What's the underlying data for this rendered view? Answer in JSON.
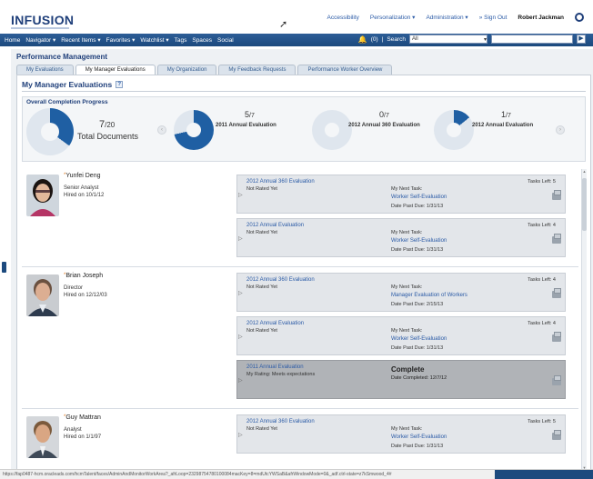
{
  "header": {
    "logo_text": "INFUSION",
    "links": [
      "Accessibility",
      "Personalization ▾",
      "Administration ▾",
      "» Sign Out"
    ],
    "user_name": "Robert Jackman"
  },
  "nav": {
    "items": [
      "Home",
      "Navigator ▾",
      "Recent Items ▾",
      "Favorites ▾",
      "Watchlist ▾",
      "Tags",
      "Spaces",
      "Social"
    ],
    "notifications": "(0)",
    "search_label": "Search",
    "search_scope": "All",
    "go_label": "▶"
  },
  "page": {
    "section_title": "Performance Management",
    "tabs": [
      "My Evaluations",
      "My Manager Evaluations",
      "My Organization",
      "My Feedback Requests",
      "Performance Worker Overview"
    ],
    "active_tab": "My Manager Evaluations",
    "panel_title": "My Manager Evaluations",
    "help_label": "?"
  },
  "completion": {
    "title": "Overall Completion Progress",
    "total": {
      "done": "7",
      "of": "/20",
      "label": "Total Documents",
      "fraction": 0.35
    },
    "items": [
      {
        "done": "5",
        "of": "/7",
        "name": "2011 Annual Evaluation",
        "fraction": 0.714
      },
      {
        "done": "0",
        "of": "/7",
        "name": "2012 Annual 360 Evaluation",
        "fraction": 0.0
      },
      {
        "done": "1",
        "of": "/7",
        "name": "2012 Annual Evaluation",
        "fraction": 0.143
      }
    ],
    "prev_label": "‹",
    "next_label": "›",
    "color_done": "#1f5fa3",
    "color_remaining": "#dfe6ee"
  },
  "employees": [
    {
      "name": "Yunfei Deng",
      "title": "Senior Analyst",
      "hired": "Hired on 10/1/12",
      "tasks": [
        {
          "name": "2012 Annual 360 Evaluation",
          "rating": "Not Rated Yet",
          "next_label": "My Next Task:",
          "next_task": "Worker Self-Evaluation",
          "due": "Date Past Due: 1/31/13",
          "left": "Tasks Left: 5"
        },
        {
          "name": "2012 Annual Evaluation",
          "rating": "Not Rated Yet",
          "next_label": "My Next Task:",
          "next_task": "Worker Self-Evaluation",
          "due": "Date Past Due: 1/31/13",
          "left": "Tasks Left: 4"
        }
      ]
    },
    {
      "name": "Brian Joseph",
      "title": "Director",
      "hired": "Hired on 12/12/03",
      "tasks": [
        {
          "name": "2012 Annual 360 Evaluation",
          "rating": "Not Rated Yet",
          "next_label": "My Next Task:",
          "next_task": "Manager Evaluation of Workers",
          "due": "Date Past Due: 2/15/13",
          "left": "Tasks Left: 4"
        },
        {
          "name": "2012 Annual Evaluation",
          "rating": "Not Rated Yet",
          "next_label": "My Next Task:",
          "next_task": "Worker Self-Evaluation",
          "due": "Date Past Due: 1/31/13",
          "left": "Tasks Left: 4"
        },
        {
          "name": "2011 Annual Evaluation",
          "rating": "My Rating: Meets expectations",
          "complete_label": "Complete",
          "completed": "Date Completed: 12/7/12"
        }
      ]
    },
    {
      "name": "Guy Mattran",
      "title": "Analyst",
      "hired": "Hired on 1/1/97",
      "tasks": [
        {
          "name": "2012 Annual 360 Evaluation",
          "rating": "Not Rated Yet",
          "next_label": "My Next Task:",
          "next_task": "Worker Self-Evaluation",
          "due": "Date Past Due: 1/31/13",
          "left": "Tasks Left: 5"
        }
      ]
    }
  ],
  "statusbar": {
    "url": "https://fap0487-hcm.oracleads.com/hcmTalent/faces/AdminAndMonitorWorkArea?_afrLoop=23298754780100084macKey=8=mdUtcYWSaB&afrWindowMode=0&_adf.ctrl-state=z7kSmwood_4#"
  }
}
